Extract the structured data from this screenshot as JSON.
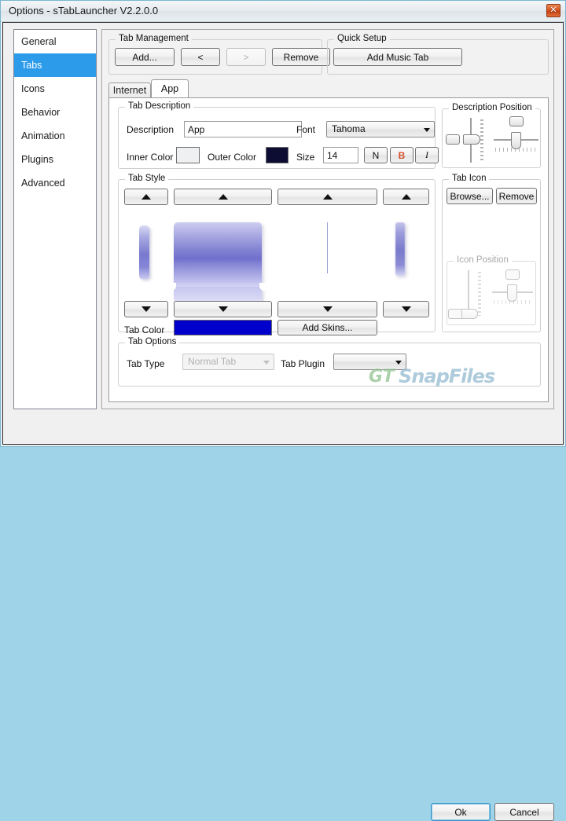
{
  "window": {
    "title": "Options - sTabLauncher V2.2.0.0",
    "close_label": "✕",
    "close_icon": "close-icon"
  },
  "sidebar": {
    "items": [
      {
        "label": "General",
        "selected": false
      },
      {
        "label": "Tabs",
        "selected": true
      },
      {
        "label": "Icons",
        "selected": false
      },
      {
        "label": "Behavior",
        "selected": false
      },
      {
        "label": "Animation",
        "selected": false
      },
      {
        "label": "Plugins",
        "selected": false
      },
      {
        "label": "Advanced",
        "selected": false
      }
    ],
    "selected_color": "#2c9bea"
  },
  "tab_management": {
    "caption": "Tab Management",
    "add_label": "Add...",
    "prev_label": "<",
    "next_label": ">",
    "next_disabled": true,
    "remove_label": "Remove"
  },
  "quick_setup": {
    "caption": "Quick Setup",
    "add_music_tab_label": "Add Music Tab"
  },
  "tabs": {
    "items": [
      {
        "label": "Internet",
        "active": false
      },
      {
        "label": "App",
        "active": true
      }
    ]
  },
  "tab_description": {
    "caption": "Tab Description",
    "description_label": "Description",
    "description_value": "App",
    "description_placeholder": "",
    "font_label": "Font",
    "font_value": "Tahoma",
    "inner_color_label": "Inner Color",
    "inner_color_value": "#eff0f2",
    "outer_color_label": "Outer Color",
    "outer_color_value": "#0d0d33",
    "size_label": "Size",
    "size_value": "14",
    "normal_label": "N",
    "bold_label": "B",
    "bold_color": "#d4502a",
    "italic_label": "I"
  },
  "description_position": {
    "caption": "Description Position",
    "vertical_value": 52,
    "horizontal_value": 50
  },
  "tab_style": {
    "caption": "Tab Style",
    "up_icon": "triangle-up-icon",
    "down_icon": "triangle-down-icon",
    "columns": [
      {
        "name": "style-narrow-left"
      },
      {
        "name": "style-wide-main"
      },
      {
        "name": "style-thin-line"
      },
      {
        "name": "style-narrow-right"
      }
    ],
    "tab_color_label": "Tab Color",
    "tab_color_value": "#0000cc",
    "add_skins_label": "Add Skins...",
    "preview_gradient_top": "#ccccf2",
    "preview_gradient_mid": "#6a6ac8",
    "preview_gradient_bottom": "#cfcff5"
  },
  "tab_icon": {
    "caption": "Tab Icon",
    "browse_label": "Browse...",
    "remove_label": "Remove",
    "icon_position_caption": "Icon Position",
    "icon_position_disabled": true,
    "vertical_value": 5,
    "horizontal_value": 50
  },
  "tab_options": {
    "caption": "Tab Options",
    "tab_type_label": "Tab Type",
    "tab_type_value": "Normal Tab",
    "tab_type_disabled": true,
    "tab_plugin_label": "Tab Plugin",
    "tab_plugin_value": ""
  },
  "footer": {
    "ok_label": "Ok",
    "cancel_label": "Cancel"
  },
  "watermark": {
    "logo": "GT",
    "text": "SnapFiles"
  }
}
